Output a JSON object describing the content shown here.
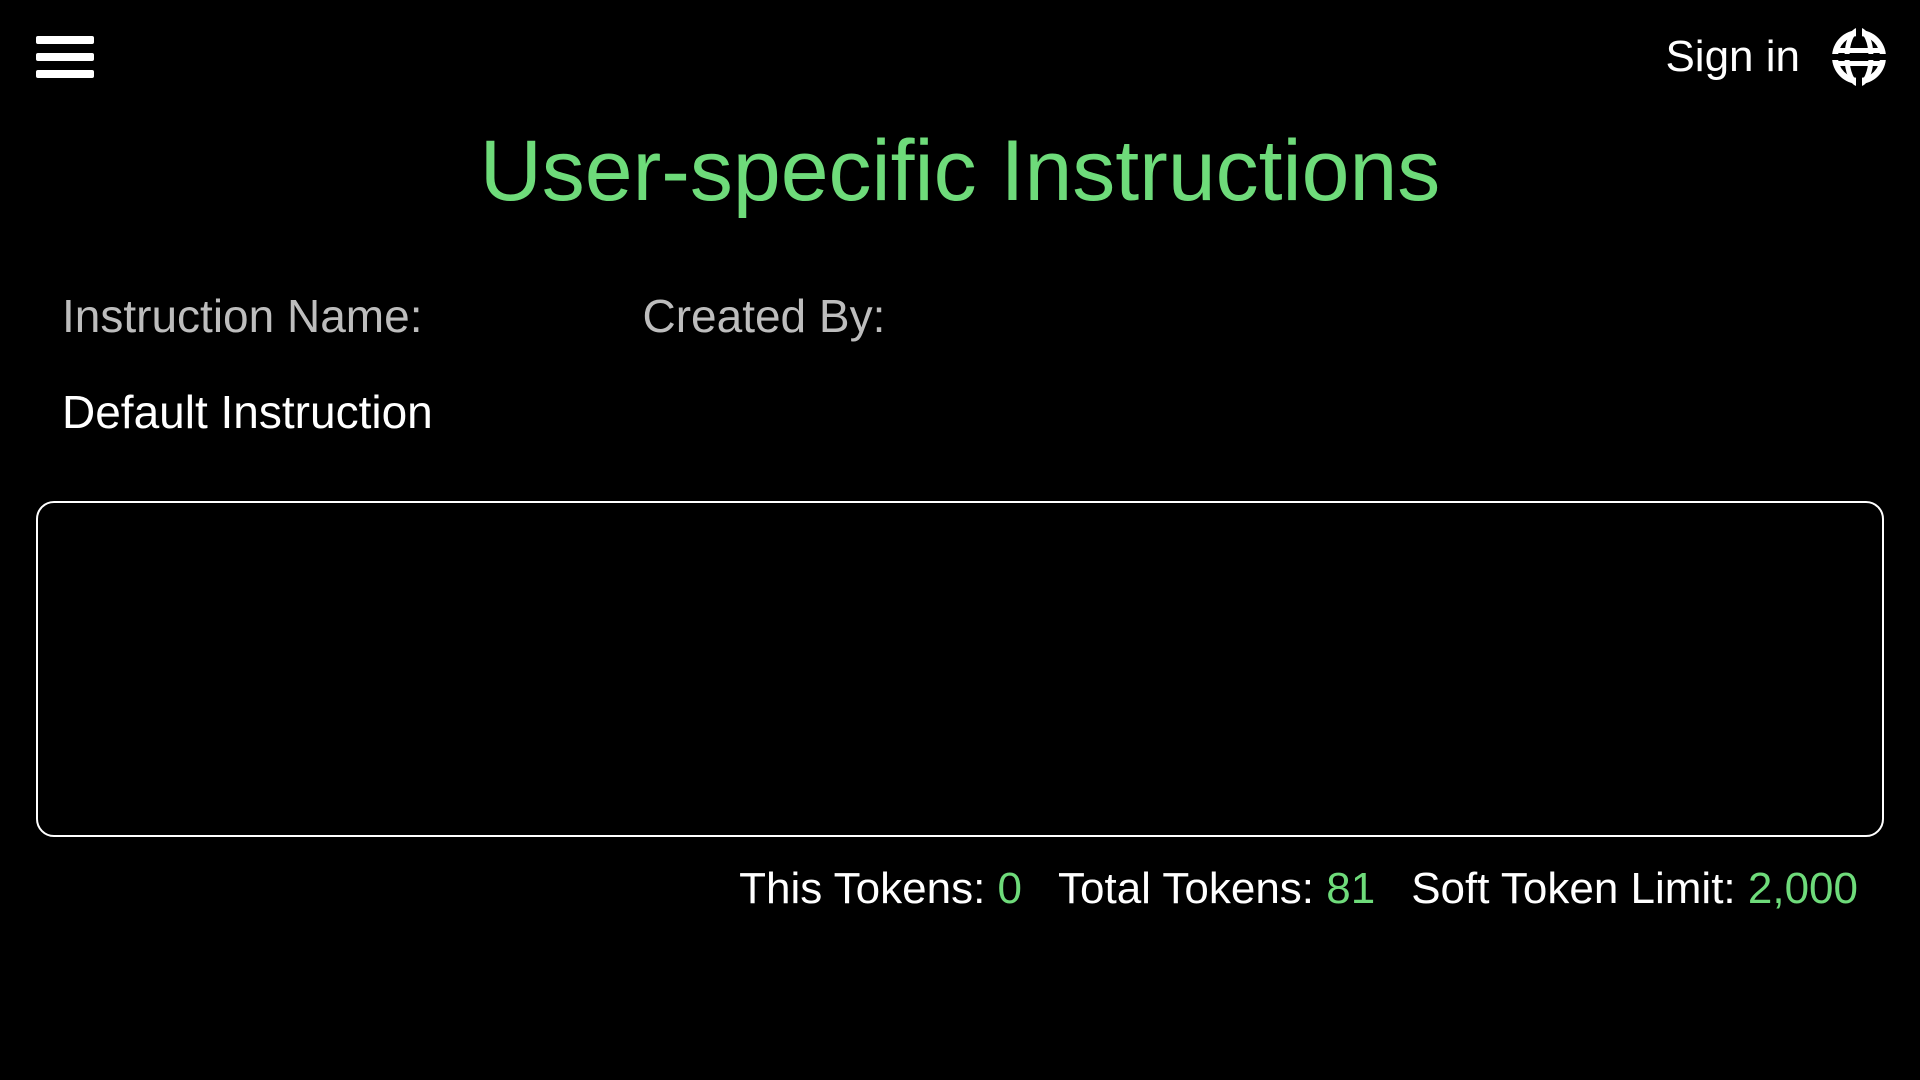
{
  "header": {
    "signin_label": "Sign in"
  },
  "page": {
    "title": "User-specific Instructions",
    "instruction_name_label": "Instruction Name:",
    "created_by_label": "Created By:",
    "instruction_name_value": "Default Instruction",
    "created_by_value": "",
    "textarea_value": ""
  },
  "tokens": {
    "this_label": "This Tokens: ",
    "this_value": "0",
    "total_label": "Total Tokens: ",
    "total_value": "81",
    "limit_label": "Soft Token Limit: ",
    "limit_value": "2,000"
  },
  "colors": {
    "accent": "#6edb7a",
    "muted": "#bdbdbd"
  }
}
